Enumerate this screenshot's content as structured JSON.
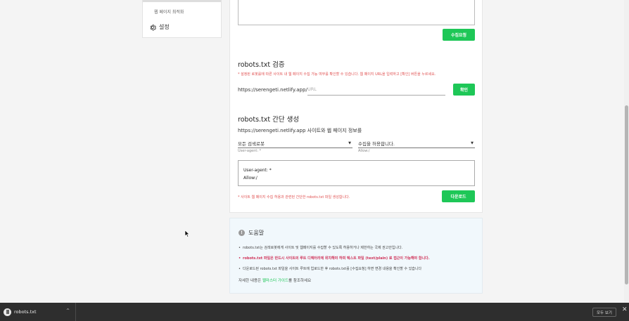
{
  "sidebar": {
    "sub_item": "웹 페이지 최적화",
    "settings_label": "설정"
  },
  "collect": {
    "request_button": "수집요청"
  },
  "robots_verify": {
    "title": "robots.txt 검증",
    "note": "* 설정된 로봇룰에 따른 사이트 내 웹 페이지 수집 가능 여부를 확인할 수 있습니다. 웹 페이지 URL을 입력하고 [확인] 버튼을 누르세요.",
    "url_prefix": "https://serengeti.netlify.app/",
    "url_placeholder": "URL",
    "confirm_button": "확인"
  },
  "robots_generate": {
    "title": "robots.txt 간단 생성",
    "subtitle": "https://serengeti.netlify.app 사이트와 웹 페이지 정보를",
    "agent_select": {
      "value": "모든 검색로봇",
      "help": "User-agent: *"
    },
    "allow_select": {
      "value": "수집을 허용합니다.",
      "help": "Allow:/"
    },
    "preview_lines": [
      "User-agent: *",
      "Allow:/"
    ],
    "note": "* 사이트 웹 페이지 수집 허용과 관련된 간단한 robots.txt 파일 생성합니다.",
    "download_button": "다운로드"
  },
  "help": {
    "title": "도움말",
    "items": [
      "robots.txt는 검색로봇에게 사이트 및 웹페이지를 수집할 수 있도록 허용하거나 제한하는 국제 권고안입니다.",
      "robots.txt 파일은 반드시 사이트의 루트 디렉터리에 위치해야 하며 텍스트 파일 (text/plain) 로 접근이 가능해야 합니다.",
      "다운로드된 robots.txt 파일을 사이트 루트에 업로드한 후 robots.txt를 [수집요청] 하면 변경 내용을 확인할 수 있습니다"
    ],
    "footer_prefix": "자세한 내용은 ",
    "footer_link": "웹마스터 가이드",
    "footer_suffix": "를 참조하세요"
  },
  "download_bar": {
    "file_name": "robots.txt",
    "show_all": "모두 보기"
  },
  "colors": {
    "accent": "#1ec757",
    "note_red": "#e05050",
    "emphasis": "#d0345a"
  }
}
